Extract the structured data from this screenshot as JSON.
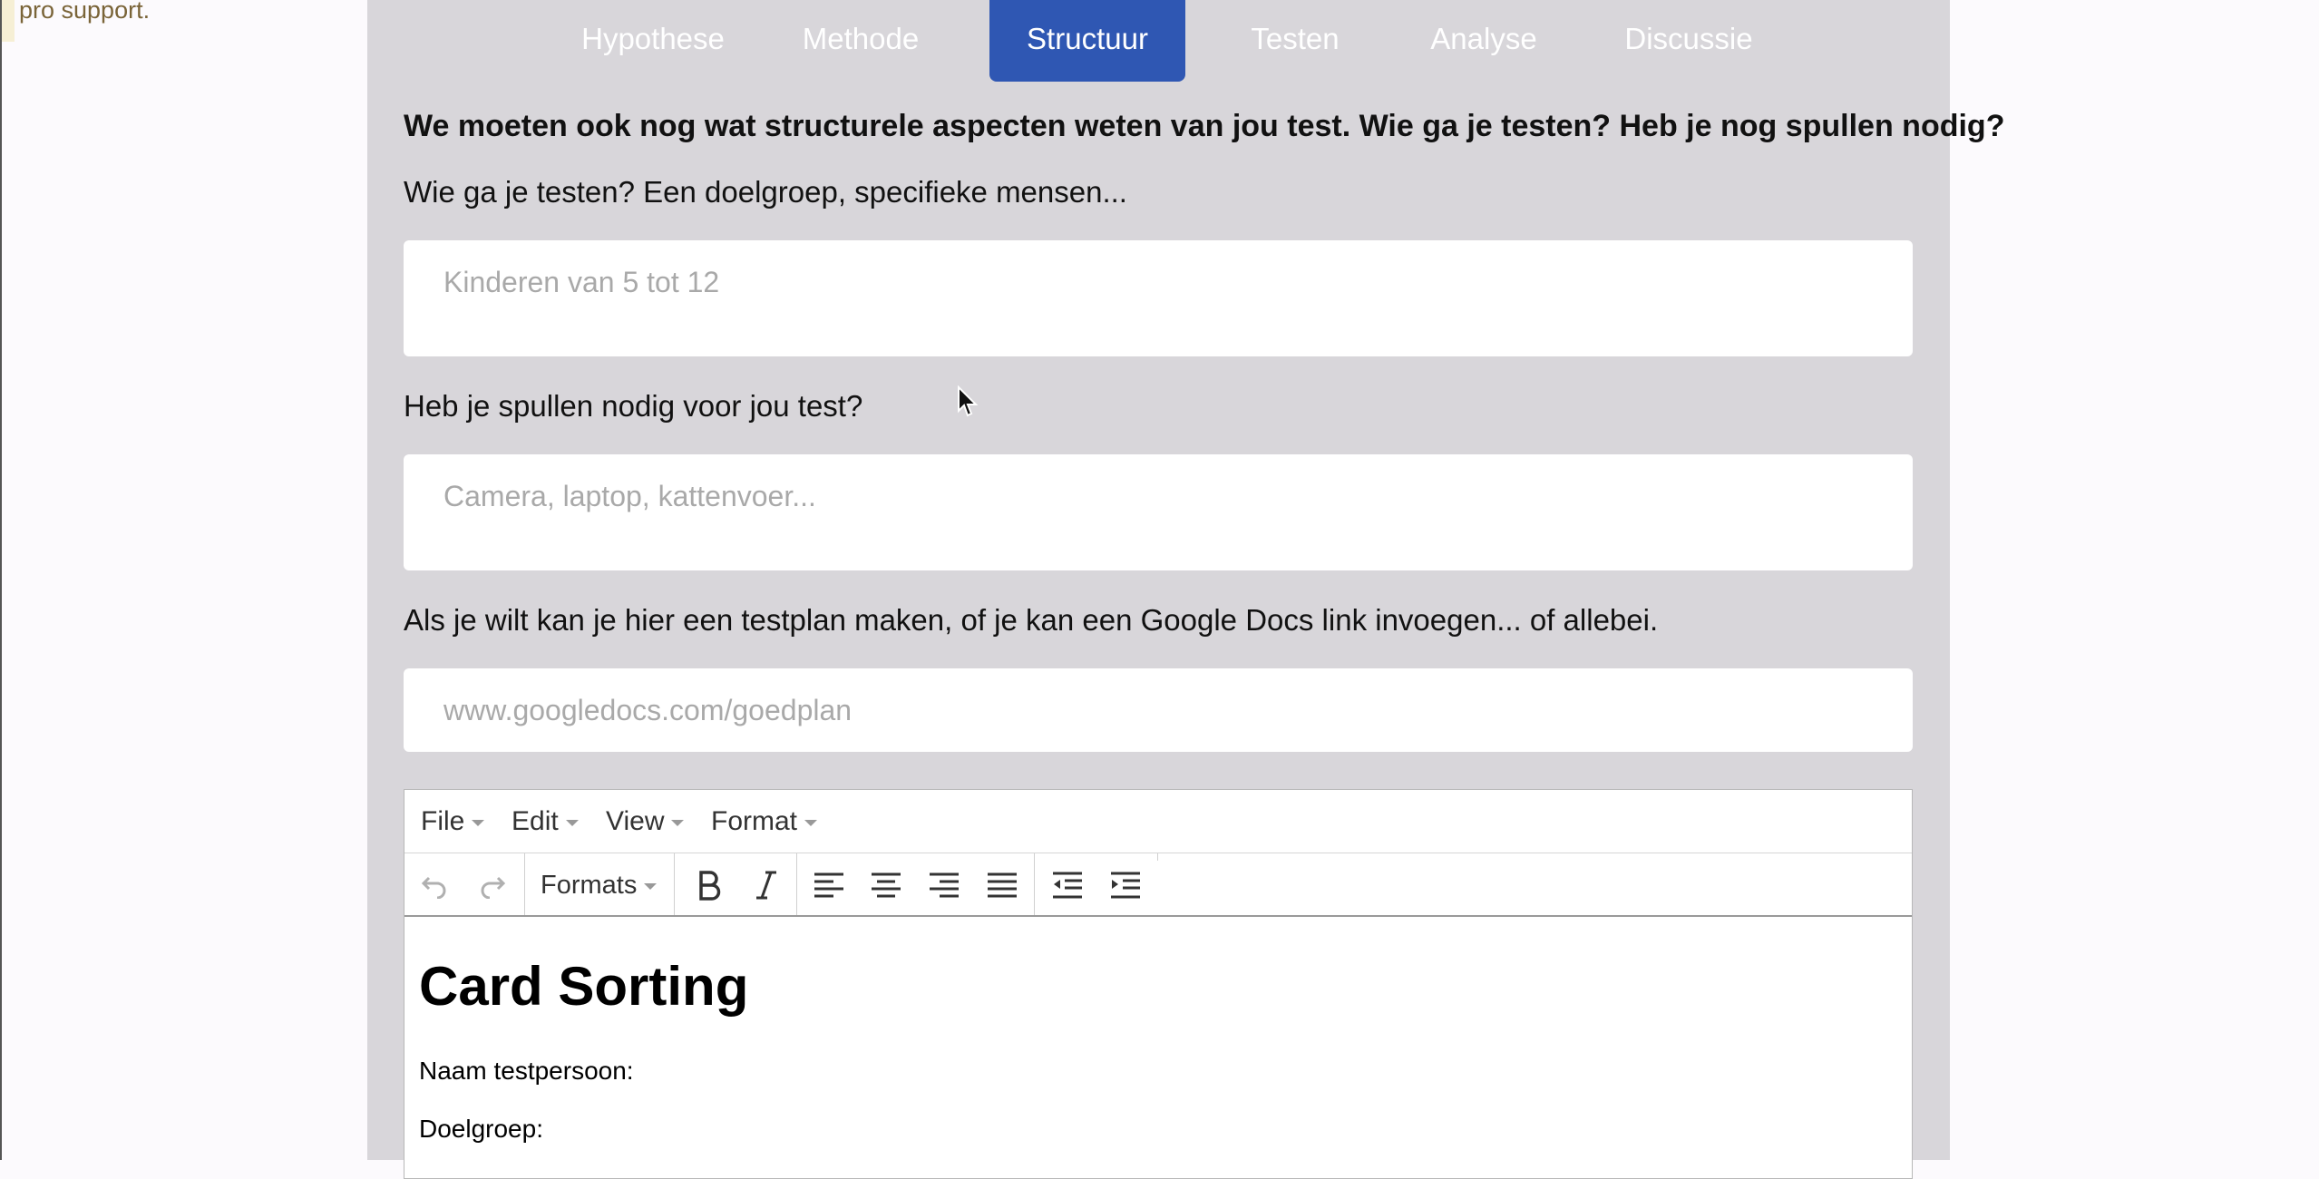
{
  "left_note": "pro support.",
  "tabs": [
    {
      "label": "Hypothese",
      "active": false
    },
    {
      "label": "Methode",
      "active": false
    },
    {
      "label": "Structuur",
      "active": true
    },
    {
      "label": "Testen",
      "active": false
    },
    {
      "label": "Analyse",
      "active": false
    },
    {
      "label": "Discussie",
      "active": false
    }
  ],
  "form": {
    "heading": "We moeten ook nog wat structurele aspecten weten van jou test. Wie ga je testen? Heb je nog spullen nodig?",
    "who_label": "Wie ga je testen? Een doelgroep, specifieke mensen...",
    "who_placeholder": "Kinderen van 5 tot 12",
    "stuff_label": "Heb je spullen nodig voor jou test?",
    "stuff_placeholder": "Camera, laptop, kattenvoer...",
    "plan_label": "Als je wilt kan je hier een testplan maken, of je kan een Google Docs link invoegen... of allebei.",
    "link_placeholder": "www.googledocs.com/goedplan"
  },
  "editor": {
    "menu": [
      "File",
      "Edit",
      "View",
      "Format"
    ],
    "formats_label": "Formats",
    "toolbar_icons": [
      "undo-icon",
      "redo-icon",
      "bold-icon",
      "italic-icon",
      "align-left-icon",
      "align-center-icon",
      "align-right-icon",
      "align-justify-icon",
      "outdent-icon",
      "indent-icon"
    ],
    "doc_title": "Card Sorting",
    "doc_lines": [
      "Naam testpersoon:",
      "Doelgroep:"
    ]
  },
  "colors": {
    "active_tab": "#2f57b3",
    "panel_bg": "#d8d6da",
    "page_bg": "#fcfafd"
  }
}
